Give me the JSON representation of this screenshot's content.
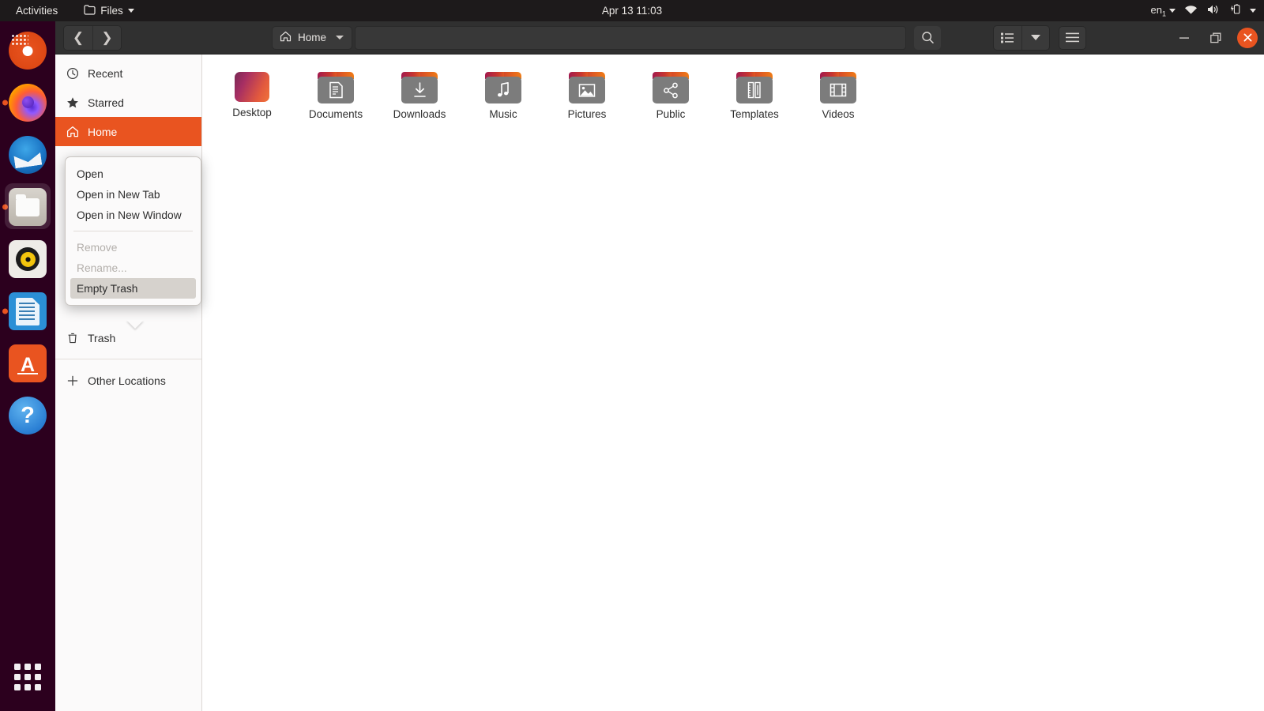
{
  "topbar": {
    "activities": "Activities",
    "app_name": "Files",
    "app_icon": "folder-icon",
    "clock": "Apr 13  11:03",
    "keyboard_layout": "en",
    "keyboard_sub": "1",
    "icons": [
      "wifi-icon",
      "volume-icon",
      "battery-icon"
    ]
  },
  "dock": {
    "items": [
      {
        "name": "ubuntu-logo",
        "label": "Ubuntu",
        "running": false,
        "focused": false
      },
      {
        "name": "firefox",
        "label": "Firefox",
        "running": true,
        "focused": false
      },
      {
        "name": "thunderbird",
        "label": "Thunderbird",
        "running": false,
        "focused": false
      },
      {
        "name": "files",
        "label": "Files",
        "running": true,
        "focused": true
      },
      {
        "name": "rhythmbox",
        "label": "Rhythmbox",
        "running": false,
        "focused": false
      },
      {
        "name": "libreoffice-writer",
        "label": "LibreOffice Writer",
        "running": true,
        "focused": false
      },
      {
        "name": "ubuntu-software",
        "label": "Ubuntu Software",
        "running": false,
        "focused": false
      },
      {
        "name": "help",
        "label": "Help",
        "running": false,
        "focused": false
      }
    ],
    "show_applications": "Show Applications"
  },
  "window": {
    "headerbar": {
      "back": "Back",
      "forward": "Forward",
      "path_label": "Home",
      "path_icon": "home-icon",
      "location_value": "",
      "location_placeholder": "",
      "search": "Search",
      "list_view": "List view",
      "view_options": "View options",
      "menu": "Main menu",
      "minimize": "Minimize",
      "maximize": "Restore",
      "close": "Close"
    },
    "sidebar": {
      "items": [
        {
          "label": "Recent",
          "icon": "clock-icon",
          "selected": false
        },
        {
          "label": "Starred",
          "icon": "star-icon",
          "selected": false
        },
        {
          "label": "Home",
          "icon": "home-icon",
          "selected": true
        },
        {
          "label": "Trash",
          "icon": "trash-icon",
          "selected": false
        },
        {
          "label": "Other Locations",
          "icon": "plus-icon",
          "selected": false
        }
      ]
    },
    "files": [
      {
        "label": "Desktop",
        "icon": "desktop-folder"
      },
      {
        "label": "Documents",
        "icon": "document-folder"
      },
      {
        "label": "Downloads",
        "icon": "download-folder"
      },
      {
        "label": "Music",
        "icon": "music-folder"
      },
      {
        "label": "Pictures",
        "icon": "pictures-folder"
      },
      {
        "label": "Public",
        "icon": "share-folder"
      },
      {
        "label": "Templates",
        "icon": "templates-folder"
      },
      {
        "label": "Videos",
        "icon": "videos-folder"
      }
    ]
  },
  "context_menu": {
    "items": [
      {
        "label": "Open",
        "state": "normal"
      },
      {
        "label": "Open in New Tab",
        "state": "normal"
      },
      {
        "label": "Open in New Window",
        "state": "normal"
      },
      {
        "label": "Remove",
        "state": "disabled"
      },
      {
        "label": "Rename...",
        "state": "disabled"
      },
      {
        "label": "Empty Trash",
        "state": "highlighted"
      }
    ]
  },
  "colors": {
    "accent": "#e95420",
    "dock_bg": "#2c001e",
    "topbar_bg": "#1d1a1b",
    "headerbar_bg": "#303030",
    "sidebar_bg": "#fbfafa"
  }
}
